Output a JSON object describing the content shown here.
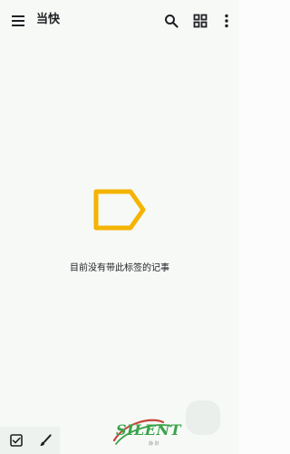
{
  "topbar": {
    "title": "当快",
    "icons": {
      "menu": "menu-icon",
      "search": "search-icon",
      "grid": "grid-view-icon",
      "more": "more-vertical-icon"
    }
  },
  "empty_state": {
    "icon": "label-outline-icon",
    "message": "目前没有带此标签的记事",
    "accent_color": "#f4b400"
  },
  "bottom_toolbar": {
    "icons": {
      "checkbox": "checkbox-icon",
      "brush": "brush-icon"
    }
  },
  "watermark": {
    "brand": "SILENT",
    "subtext": "静 默",
    "brand_color": "#3aa34a"
  }
}
